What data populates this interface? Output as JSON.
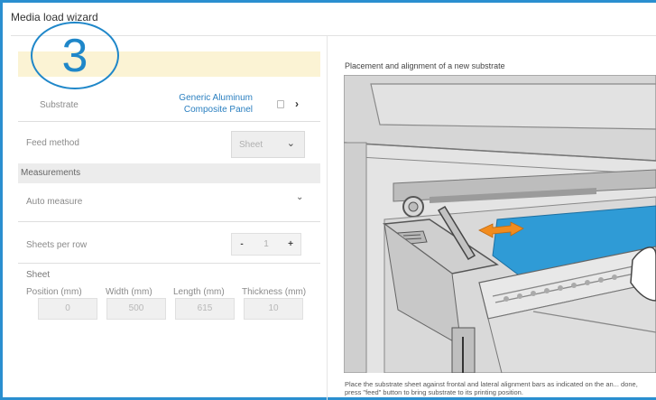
{
  "window": {
    "title": "Media load wizard"
  },
  "step": {
    "number": "3"
  },
  "form": {
    "substrate_label": "Substrate",
    "substrate_value": "Generic Aluminum Composite Panel",
    "feed_method_label": "Feed method",
    "feed_method_value": "Sheet",
    "measurements_header": "Measurements",
    "auto_measure_label": "Auto measure",
    "sheets_per_row_label": "Sheets per row",
    "sheets_per_row_value": "1",
    "stepper_minus": "-",
    "stepper_plus": "+",
    "sheet_header": "Sheet",
    "sheet_columns": [
      "Position (mm)",
      "Width (mm)",
      "Length (mm)",
      "Thickness (mm)"
    ],
    "sheet_values": [
      "0",
      "500",
      "615",
      "10"
    ]
  },
  "guide": {
    "caption": "Placement and alignment of a new substrate",
    "instructions": "Place the substrate sheet against frontal and lateral alignment bars as indicated on the an... done, press \"feed\" button to bring substrate to its printing position."
  },
  "icons": {
    "copy": "copy-icon",
    "chevron_right": "chevron-right-icon",
    "chevron_down": "chevron-down-icon"
  },
  "colors": {
    "accent": "#1f87c9",
    "link": "#2a7fc0",
    "highlight": "#fbf3d4",
    "substrate_blue": "#2f9bd6"
  }
}
